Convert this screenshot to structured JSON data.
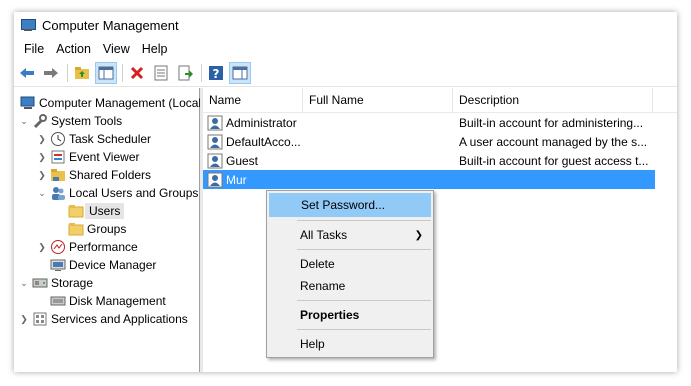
{
  "window": {
    "title": "Computer Management"
  },
  "menubar": {
    "items": [
      "File",
      "Action",
      "View",
      "Help"
    ]
  },
  "tree": {
    "items": [
      {
        "label": "Computer Management (Local",
        "level": 0,
        "chevron": "",
        "icon": "computer-management-icon"
      },
      {
        "label": "System Tools",
        "level": 0,
        "chevron": "v",
        "icon": "system-tools-icon"
      },
      {
        "label": "Task Scheduler",
        "level": 1,
        "chevron": ">",
        "icon": "task-scheduler-icon"
      },
      {
        "label": "Event Viewer",
        "level": 1,
        "chevron": ">",
        "icon": "event-viewer-icon"
      },
      {
        "label": "Shared Folders",
        "level": 1,
        "chevron": ">",
        "icon": "shared-folders-icon"
      },
      {
        "label": "Local Users and Groups",
        "level": 1,
        "chevron": "v",
        "icon": "local-users-icon"
      },
      {
        "label": "Users",
        "level": 2,
        "chevron": "",
        "icon": "folder-icon",
        "selected": true
      },
      {
        "label": "Groups",
        "level": 2,
        "chevron": "",
        "icon": "folder-icon"
      },
      {
        "label": "Performance",
        "level": 1,
        "chevron": ">",
        "icon": "performance-icon"
      },
      {
        "label": "Device Manager",
        "level": 1,
        "chevron": "",
        "icon": "device-manager-icon"
      },
      {
        "label": "Storage",
        "level": 0,
        "chevron": "v",
        "icon": "storage-icon"
      },
      {
        "label": "Disk Management",
        "level": 1,
        "chevron": "",
        "icon": "disk-management-icon"
      },
      {
        "label": "Services and Applications",
        "level": 0,
        "chevron": ">",
        "icon": "services-icon"
      }
    ]
  },
  "list": {
    "columns": [
      "Name",
      "Full Name",
      "Description"
    ],
    "rows": [
      {
        "name": "Administrator",
        "full_name": "",
        "description": "Built-in account for administering..."
      },
      {
        "name": "DefaultAcco...",
        "full_name": "",
        "description": "A user account managed by the s..."
      },
      {
        "name": "Guest",
        "full_name": "",
        "description": "Built-in account for guest access t..."
      },
      {
        "name": "Mur",
        "full_name": "",
        "description": "",
        "selected": true
      }
    ]
  },
  "context_menu": {
    "set_password": "Set Password...",
    "all_tasks": "All Tasks",
    "delete": "Delete",
    "rename": "Rename",
    "properties": "Properties",
    "help": "Help"
  },
  "colors": {
    "selection": "#3399ff",
    "menu_highlight": "#91c9f7"
  }
}
